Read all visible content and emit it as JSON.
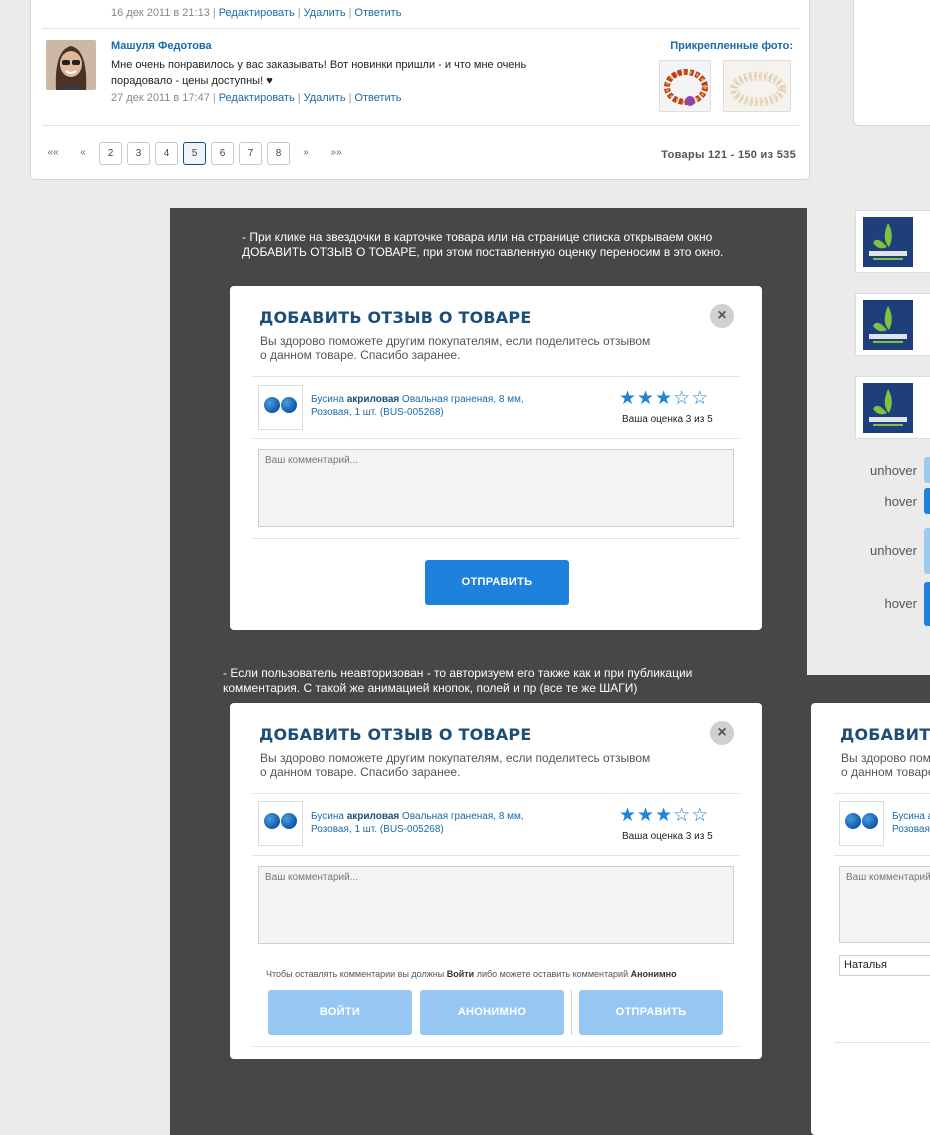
{
  "comments": {
    "prev_meta": {
      "date": "16 дек 2011 в 21:13",
      "edit": "Редактировать",
      "delete": "Удалить",
      "reply": "Ответить"
    },
    "item": {
      "author": "Машуля Федотова",
      "text": "Мне очень понравилось у вас заказывать! Вот новинки пришли - и что мне очень порадовало - цены доступны! ♥",
      "date": "27 дек 2011 в 17:47",
      "edit": "Редактировать",
      "delete": "Удалить",
      "reply": "Ответить",
      "attached_title": "Прикрепленные фото:"
    }
  },
  "pagination": {
    "first": "««",
    "prev": "«",
    "pages": [
      "2",
      "3",
      "4",
      "5",
      "6",
      "7",
      "8"
    ],
    "current": "5",
    "next": "»",
    "last": "»»",
    "range": "Товары 121 - 150 из 535"
  },
  "notes": {
    "note1": "- При клике на звездочки в карточке товара или на странице списка открываем окно ДОБАВИТЬ ОТЗЫВ О ТОВАРЕ, при этом поставленную оценку переносим в это окно.",
    "note2": "- Если пользователь неавторизован - то авторизуем его также как и при публикации комментария. С такой же анимацией кнопок, полей и пр (все те же ШАГИ)"
  },
  "right_strip": {
    "hover_labels": [
      "unhover",
      "hover",
      "unhover",
      "hover"
    ]
  },
  "modal": {
    "title": "ДОБАВИТЬ ОТЗЫВ О ТОВАРЕ",
    "subtitle_line1": "Вы здорово поможете другим покупателям, если поделитесь отзывом",
    "subtitle_line2": "о данном товаре. Спасибо заранее.",
    "close": "×",
    "product_prefix": "Бусина ",
    "product_bold": "акриловая",
    "product_line1_rest": " Овальная граненая, 8 мм,",
    "product_line2": "Розовая, 1 шт. (BUS-005268)",
    "rating": 3,
    "rating_max": 5,
    "rating_label": "Ваша оценка 3 из 5",
    "comment_placeholder": "Ваш комментарий...",
    "submit": "ОТПРАВИТЬ",
    "auth_prefix": "Чтобы оставлять комментарии вы должны ",
    "auth_login_word": "Войти",
    "auth_middle": " либо можете оставить комментарий ",
    "auth_anon_word": "Анонимно",
    "btn_login": "ВОЙТИ",
    "btn_anon": "АНОНИМНО",
    "btn_submit": "ОТПРАВИТЬ"
  },
  "modal3": {
    "title": "ДОБАВИТЬ ОТЗЫВ О ТОВАРЕ",
    "subtitle_line1": "Вы здорово поможете",
    "subtitle_line2": "о данном товаре. Спа",
    "product_prefix": "Бусина а",
    "product_line2": "Розовая,",
    "comment_placeholder": "Ваш комментарий",
    "name_value": "Наталья"
  },
  "colors": {
    "accent": "#1e81dd",
    "accent_light": "#96c7f2",
    "title": "#1c4e78",
    "link": "#1a6aa8",
    "dark_bg": "#474747"
  }
}
